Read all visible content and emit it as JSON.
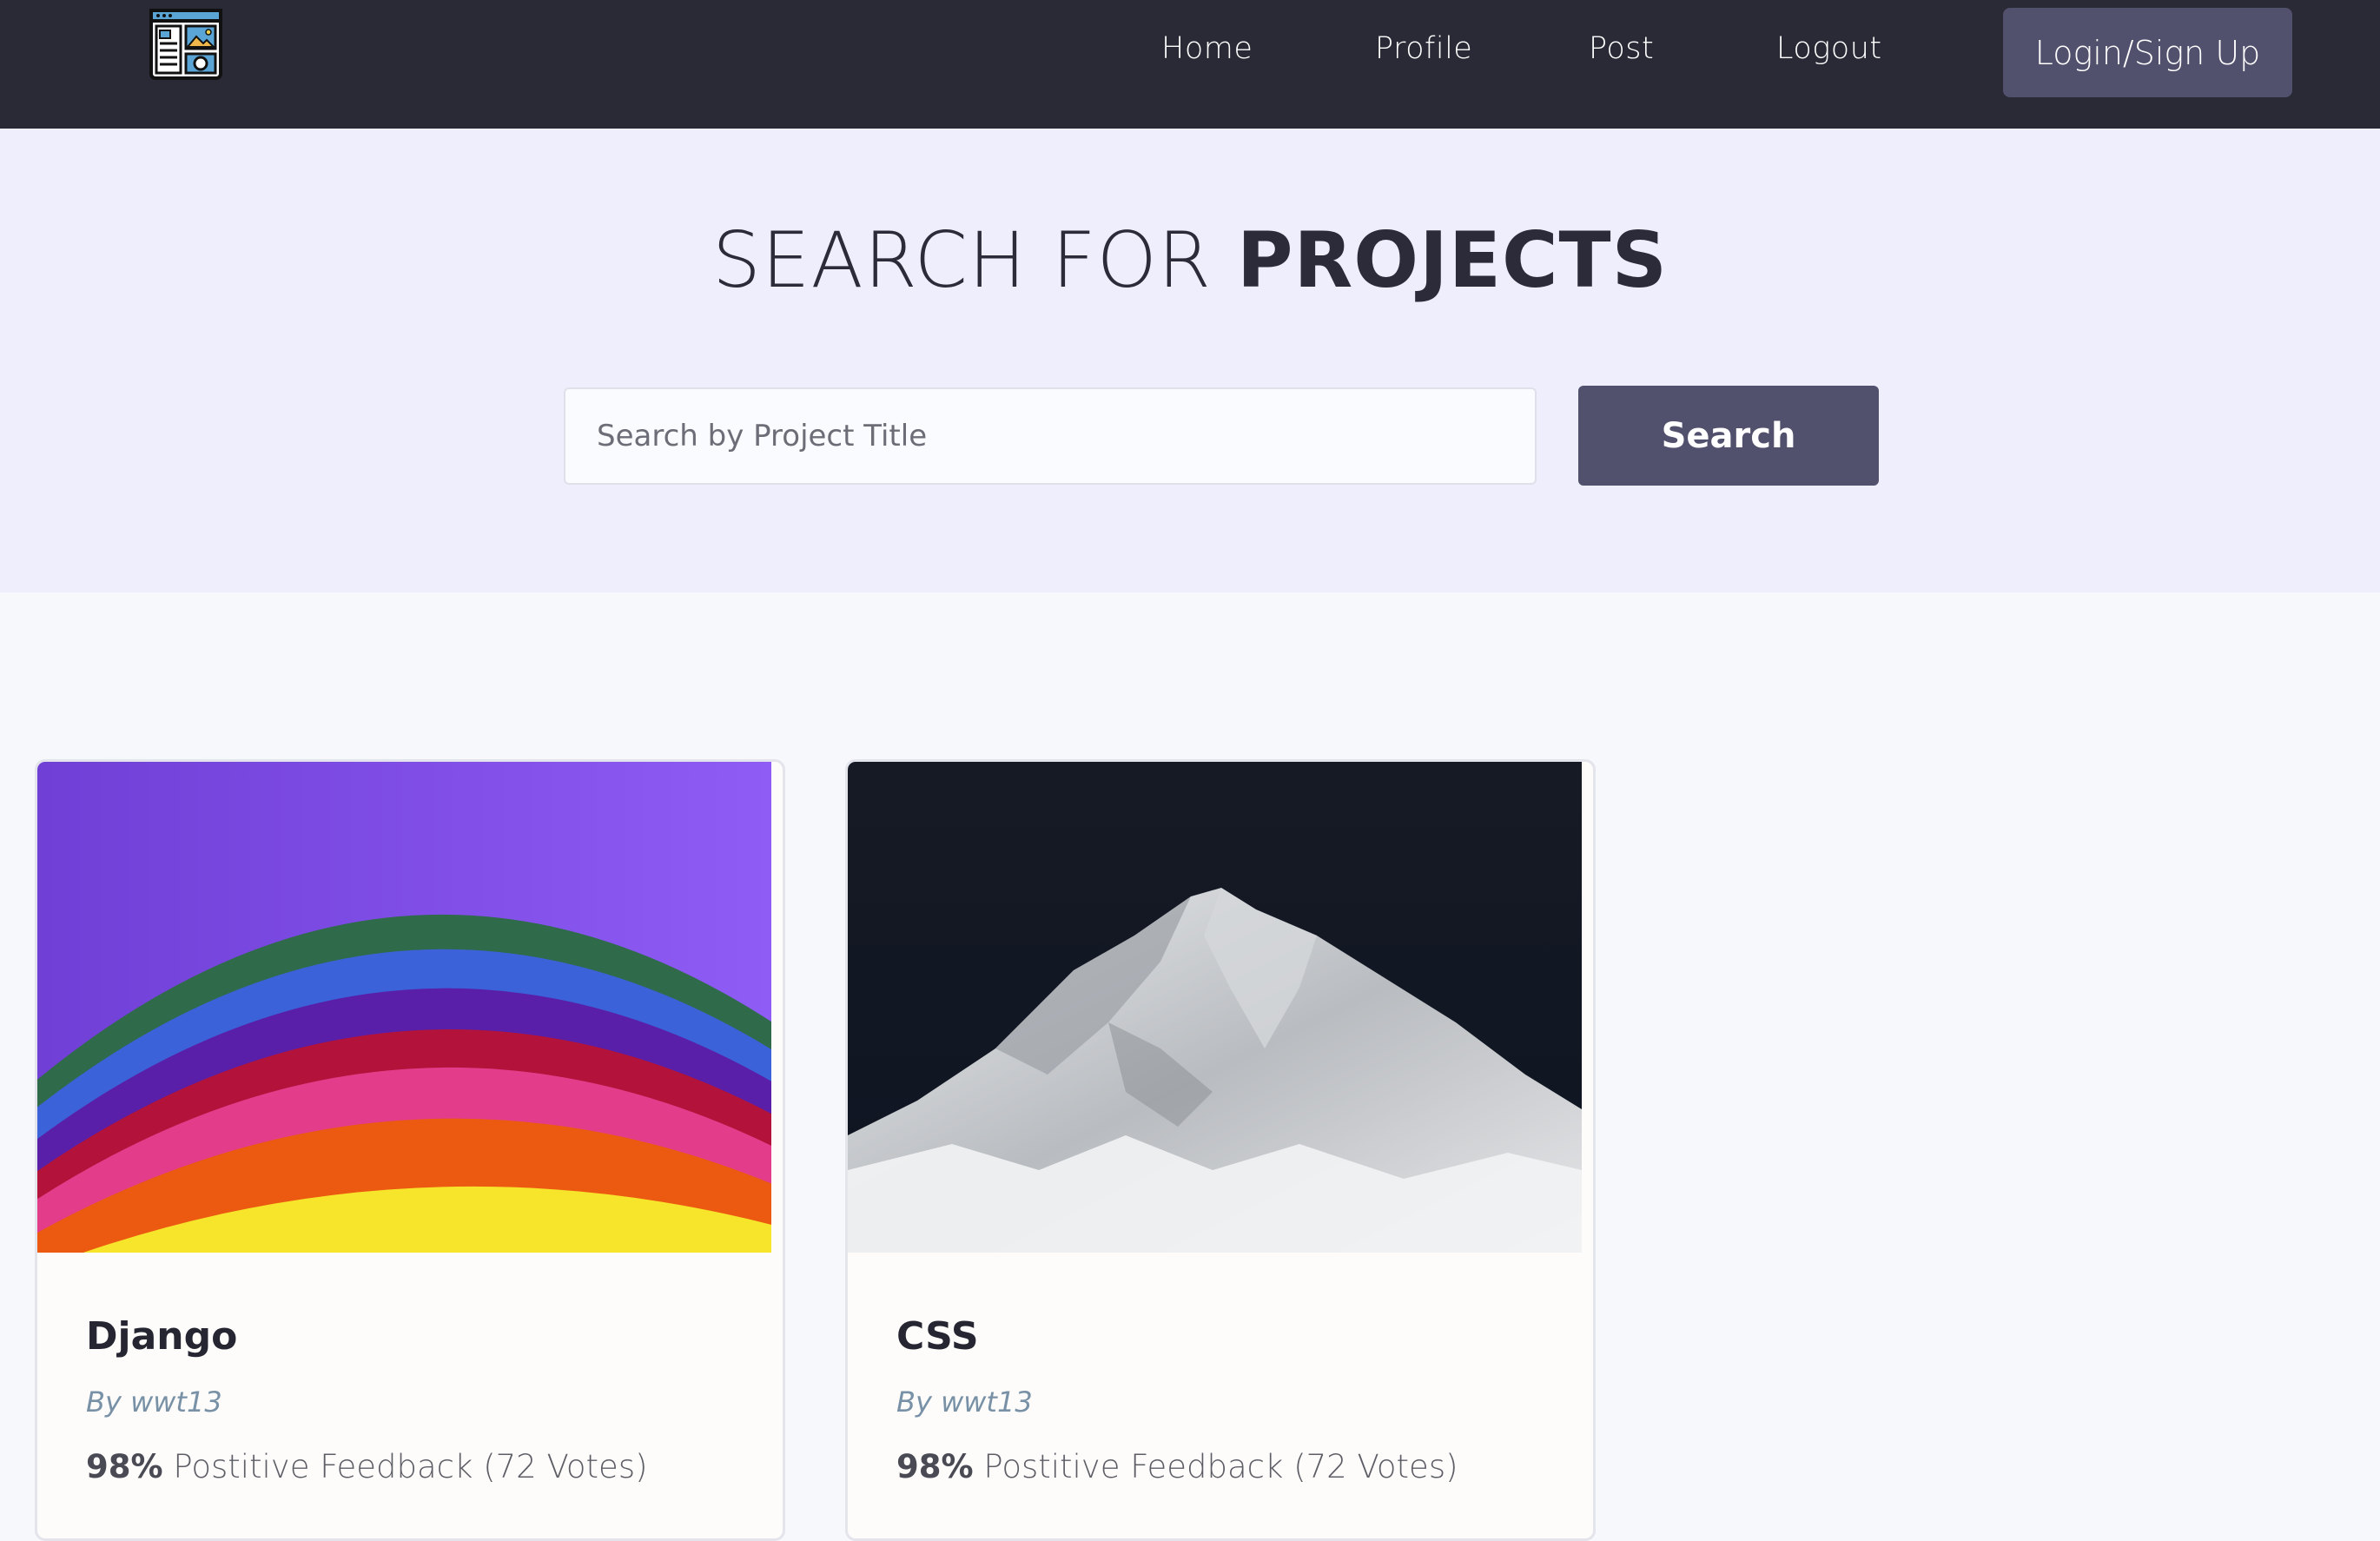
{
  "header": {
    "nav": [
      "Home",
      "Profile",
      "Post",
      "Logout"
    ],
    "login_label": "Login/Sign Up"
  },
  "hero": {
    "title_light": "SEARCH FOR ",
    "title_bold": "PROJECTS",
    "search_placeholder": "Search by Project Title",
    "search_button": "Search"
  },
  "projects": [
    {
      "title": "Django",
      "author": "By wwt13",
      "feedback_percent": "98%",
      "feedback_text": " Postitive Feedback (72 Votes)",
      "image": "rainbow-arcs"
    },
    {
      "title": "CSS",
      "author": "By wwt13",
      "feedback_percent": "98%",
      "feedback_text": " Postitive Feedback (72 Votes)",
      "image": "snowy-mountain"
    }
  ],
  "colors": {
    "header_bg": "#2a2a37",
    "accent_button": "#51506d",
    "hero_bg": "#eeeefc",
    "author_color": "#7891a6"
  }
}
